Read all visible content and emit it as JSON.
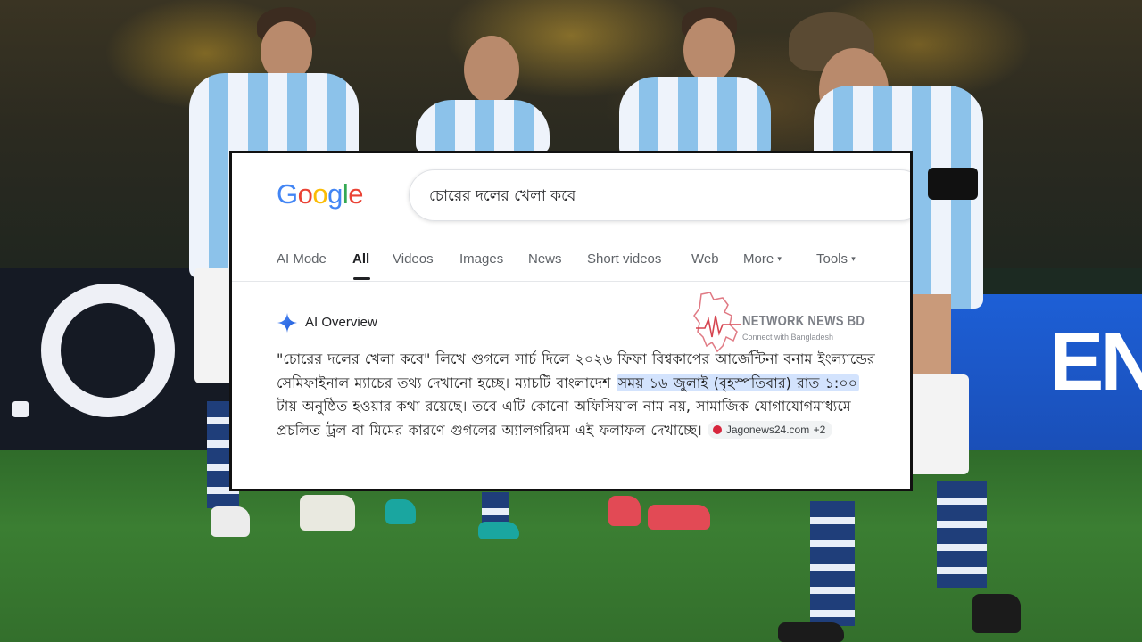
{
  "search": {
    "logo_letters": [
      "G",
      "o",
      "o",
      "g",
      "l",
      "e"
    ],
    "query": "চোরের দলের খেলা কবে"
  },
  "tabs": [
    {
      "label": "AI Mode",
      "active": false
    },
    {
      "label": "All",
      "active": true
    },
    {
      "label": "Videos",
      "active": false
    },
    {
      "label": "Images",
      "active": false
    },
    {
      "label": "News",
      "active": false
    },
    {
      "label": "Short videos",
      "active": false
    },
    {
      "label": "Web",
      "active": false
    },
    {
      "label": "More",
      "dropdown": true
    },
    {
      "label": "Tools",
      "dropdown": true
    }
  ],
  "ai_overview": {
    "icon": "sparkle-icon",
    "label": "AI Overview",
    "text_before": "\"চোরের দলের খেলা কবে\" লিখে গুগলে সার্চ দিলে ২০২৬ ফিফা বিশ্বকাপের আর্জেন্টিনা বনাম ইংল্যান্ডের সেমিফাইনাল ম্যাচের তথ্য দেখানো হচ্ছে। ম্যাচটি বাংলাদেশ ",
    "highlight": "সময় ১৬ জুলাই (বৃহস্পতিবার) রাত ১:০০",
    "text_after": " টায় অনুষ্ঠিত হওয়ার কথা রয়েছে। তবে এটি কোনো অফিসিয়াল নাম নয়, সামাজিক যোগাযোগমাধ্যমে প্রচলিত ট্রল বা মিমের কারণে গুগলের অ্যালগরিদম এই ফলাফল দেখাচ্ছে।",
    "source_label": "Jagonews24.com +2"
  },
  "watermark": {
    "title": "NETWORK NEWS BD",
    "subtitle": "Connect with Bangladesh"
  },
  "colors": {
    "google_blue": "#4285f4",
    "highlight_bg": "#d3e3fd",
    "source_icon": "#d7263d"
  }
}
